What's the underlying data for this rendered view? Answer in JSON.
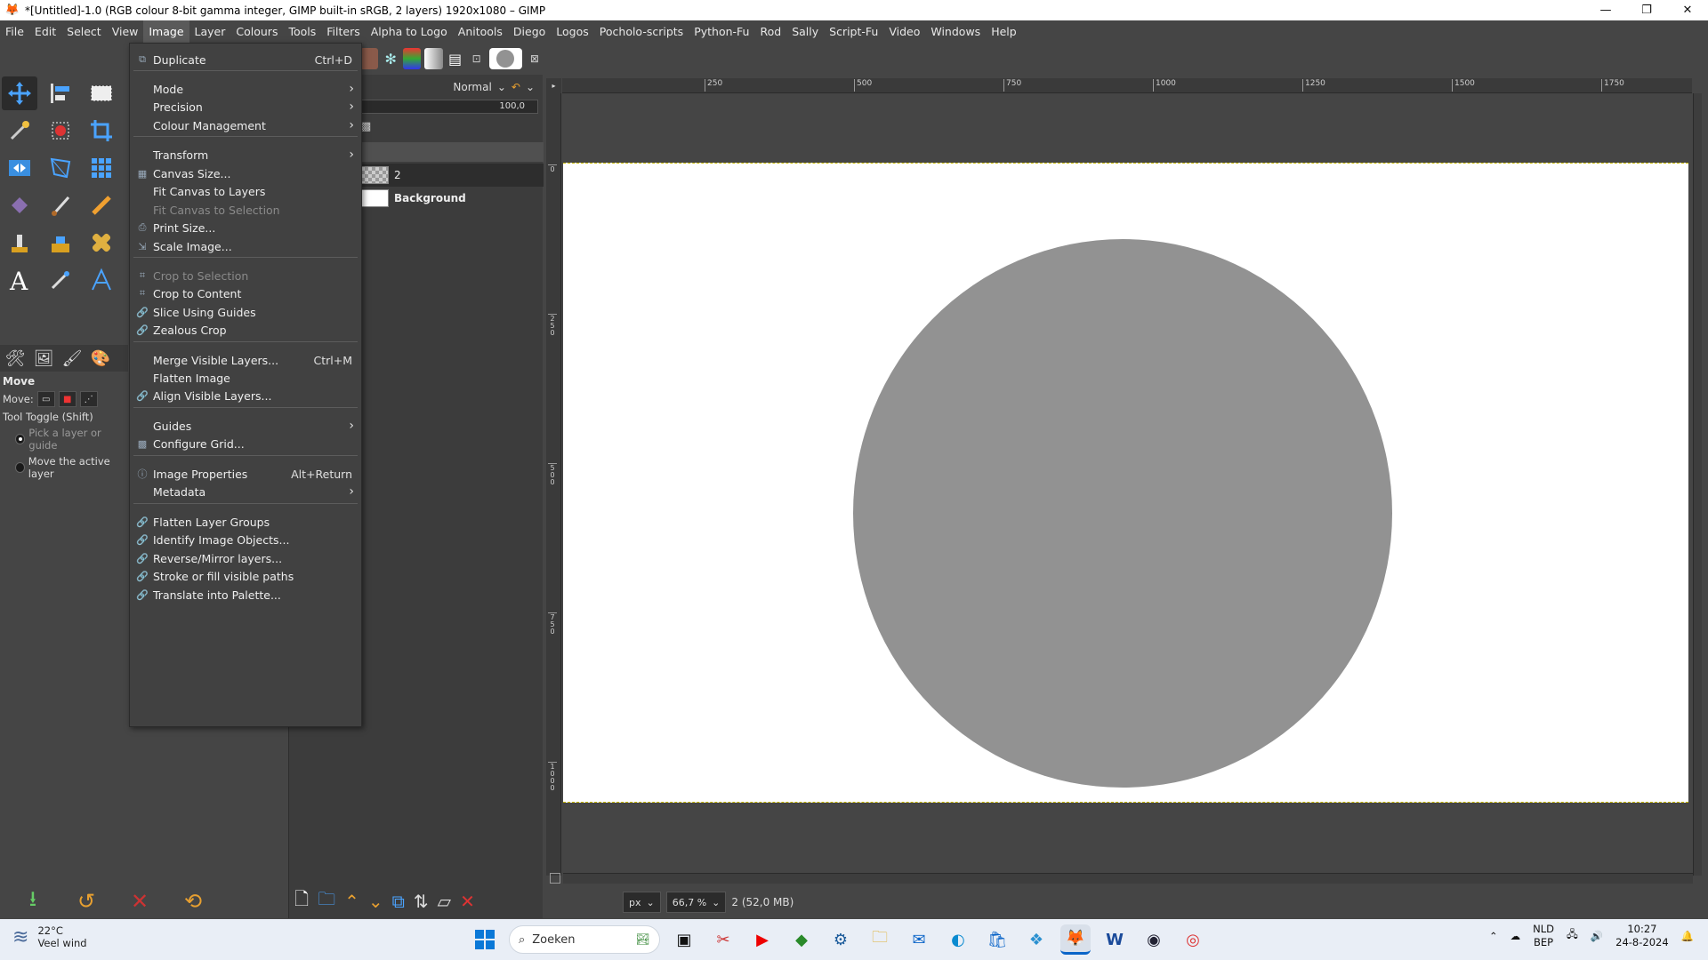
{
  "window": {
    "title": "*[Untitled]-1.0 (RGB colour 8-bit gamma integer, GIMP built-in sRGB, 2 layers) 1920x1080 – GIMP",
    "minimize": "—",
    "restore": "❐",
    "close": "✕"
  },
  "menubar": [
    "File",
    "Edit",
    "Select",
    "View",
    "Image",
    "Layer",
    "Colours",
    "Tools",
    "Filters",
    "Alpha to Logo",
    "Anitools",
    "Diego",
    "Logos",
    "Pocholo-scripts",
    "Python-Fu",
    "Rod",
    "Sally",
    "Script-Fu",
    "Video",
    "Windows",
    "Help"
  ],
  "image_menu": {
    "items": [
      {
        "label": "Duplicate",
        "accel": "Ctrl+D",
        "icon": "duplicate-icon"
      },
      {
        "label": "Mode",
        "submenu": true
      },
      {
        "label": "Precision",
        "submenu": true
      },
      {
        "label": "Colour Management",
        "submenu": true
      },
      {
        "label": "Transform",
        "submenu": true
      },
      {
        "label": "Canvas Size...",
        "icon": "canvas-icon"
      },
      {
        "label": "Fit Canvas to Layers"
      },
      {
        "label": "Fit Canvas to Selection",
        "disabled": true
      },
      {
        "label": "Print Size...",
        "icon": "print-icon"
      },
      {
        "label": "Scale Image...",
        "icon": "scale-icon"
      },
      {
        "label": "Crop to Selection",
        "disabled": true,
        "icon": "crop-icon"
      },
      {
        "label": "Crop to Content",
        "icon": "crop-icon"
      },
      {
        "label": "Slice Using Guides",
        "icon": "script-icon"
      },
      {
        "label": "Zealous Crop",
        "icon": "script-icon"
      },
      {
        "label": "Merge Visible Layers...",
        "accel": "Ctrl+M"
      },
      {
        "label": "Flatten Image"
      },
      {
        "label": "Align Visible Layers...",
        "icon": "script-icon"
      },
      {
        "label": "Guides",
        "submenu": true
      },
      {
        "label": "Configure Grid...",
        "icon": "grid-icon"
      },
      {
        "label": "Image Properties",
        "accel": "Alt+Return",
        "icon": "info-icon"
      },
      {
        "label": "Metadata",
        "submenu": true
      },
      {
        "label": "Flatten Layer Groups",
        "icon": "script-icon"
      },
      {
        "label": "Identify Image Objects...",
        "icon": "script-icon"
      },
      {
        "label": "Reverse/Mirror layers...",
        "icon": "script-icon"
      },
      {
        "label": "Stroke or fill visible paths",
        "icon": "script-icon"
      },
      {
        "label": "Translate into Palette...",
        "icon": "script-icon"
      }
    ]
  },
  "tool_options": {
    "title": "Move",
    "move_label": "Move:",
    "toggle_label": "Tool Toggle  (Shift)",
    "option_1": "Pick a layer or guide",
    "option_2": "Move the active layer"
  },
  "layers": {
    "mode": "Normal",
    "opacity": "100,0",
    "items": [
      {
        "name": "2"
      },
      {
        "name": "Background"
      }
    ]
  },
  "rulers": {
    "top": [
      "250",
      "500",
      "750",
      "1000",
      "1250",
      "1500",
      "1750"
    ],
    "left": [
      "0",
      "250",
      "500",
      "750",
      "1000"
    ]
  },
  "statusbar": {
    "unit": "px",
    "zoom": "66,7 %",
    "info": "2 (52,0 MB)"
  },
  "taskbar": {
    "weather_temp": "22°C",
    "weather_desc": "Veel wind",
    "search_placeholder": "Zoeken",
    "lang_1": "NLD",
    "lang_2": "BEP",
    "time": "10:27",
    "date": "24-8-2024"
  },
  "colors": {
    "ui_bg": "#454545",
    "canvas_bg": "#ffffff",
    "circle_fill": "#929292",
    "menu_bg": "#414141"
  }
}
